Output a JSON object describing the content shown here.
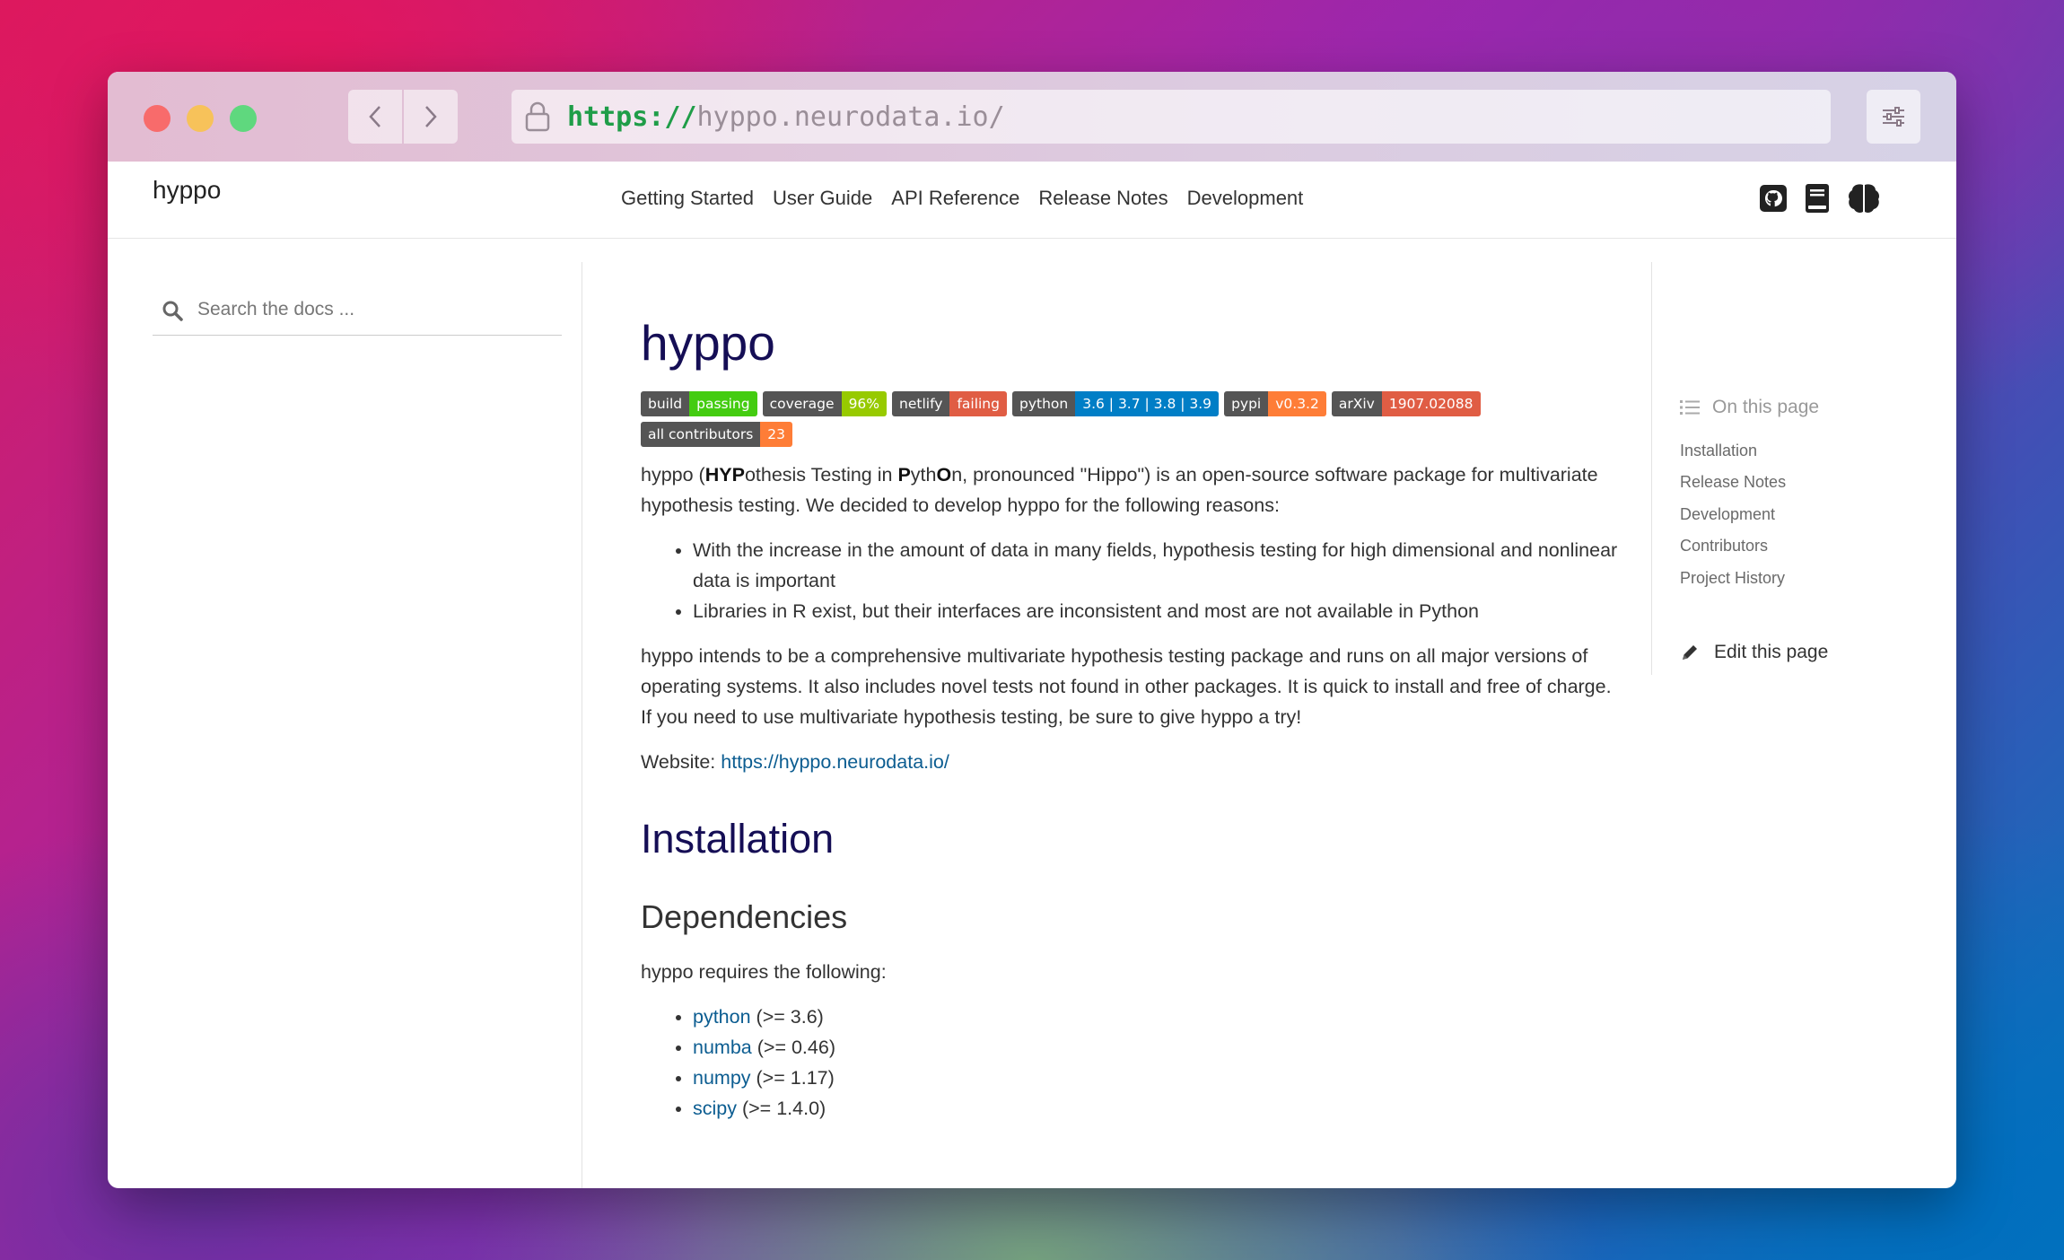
{
  "browser": {
    "url_protocol": "https://",
    "url_host": "hyppo.neurodata.io/"
  },
  "topbar": {
    "brand": "hyppo",
    "menu": [
      "Getting Started",
      "User Guide",
      "API Reference",
      "Release Notes",
      "Development"
    ]
  },
  "sidebar": {
    "search_placeholder": "Search the docs ..."
  },
  "main": {
    "title": "hyppo",
    "badges": [
      {
        "label": "build",
        "value": "passing",
        "color": "#4c1"
      },
      {
        "label": "coverage",
        "value": "96%",
        "color": "#97ca00"
      },
      {
        "label": "netlify",
        "value": "failing",
        "color": "#e05d44"
      },
      {
        "label": "python",
        "value": "3.6 | 3.7 | 3.8 | 3.9",
        "color": "#007ec6"
      },
      {
        "label": "pypi",
        "value": "v0.3.2",
        "color": "#fe7d37"
      },
      {
        "label": "arXiv",
        "value": "1907.02088",
        "color": "#e05d44"
      },
      {
        "label": "all contributors",
        "value": "23",
        "color": "#fe7d37"
      }
    ],
    "intro": {
      "p0": "hyppo (",
      "b1": "HYP",
      "p1": "othesis Testing in ",
      "b2": "P",
      "p2": "yth",
      "b3": "O",
      "p3": "n, pronounced \"Hippo\") is an open-source software package for multivariate hypothesis testing. We decided to develop hyppo for the following reasons:"
    },
    "reasons": [
      "With the increase in the amount of data in many fields, hypothesis testing for high dimensional and nonlinear data is important",
      "Libraries in R exist, but their interfaces are inconsistent and most are not available in Python"
    ],
    "para2": "hyppo intends to be a comprehensive multivariate hypothesis testing package and runs on all major versions of operating systems. It also includes novel tests not found in other packages. It is quick to install and free of charge. If you need to use multivariate hypothesis testing, be sure to give hyppo a try!",
    "website_label": "Website: ",
    "website_link": "https://hyppo.neurodata.io/",
    "installation_heading": "Installation",
    "dependencies_heading": "Dependencies",
    "requires_text": "hyppo requires the following:",
    "deps": [
      {
        "name": "python",
        "version": " (>= 3.6)"
      },
      {
        "name": "numba",
        "version": " (>= 0.46)"
      },
      {
        "name": "numpy",
        "version": " (>= 1.17)"
      },
      {
        "name": "scipy",
        "version": " (>= 1.4.0)"
      }
    ]
  },
  "toc": {
    "heading": "On this page",
    "items": [
      "Installation",
      "Release Notes",
      "Development",
      "Contributors",
      "Project History"
    ],
    "edit_label": "Edit this page"
  }
}
